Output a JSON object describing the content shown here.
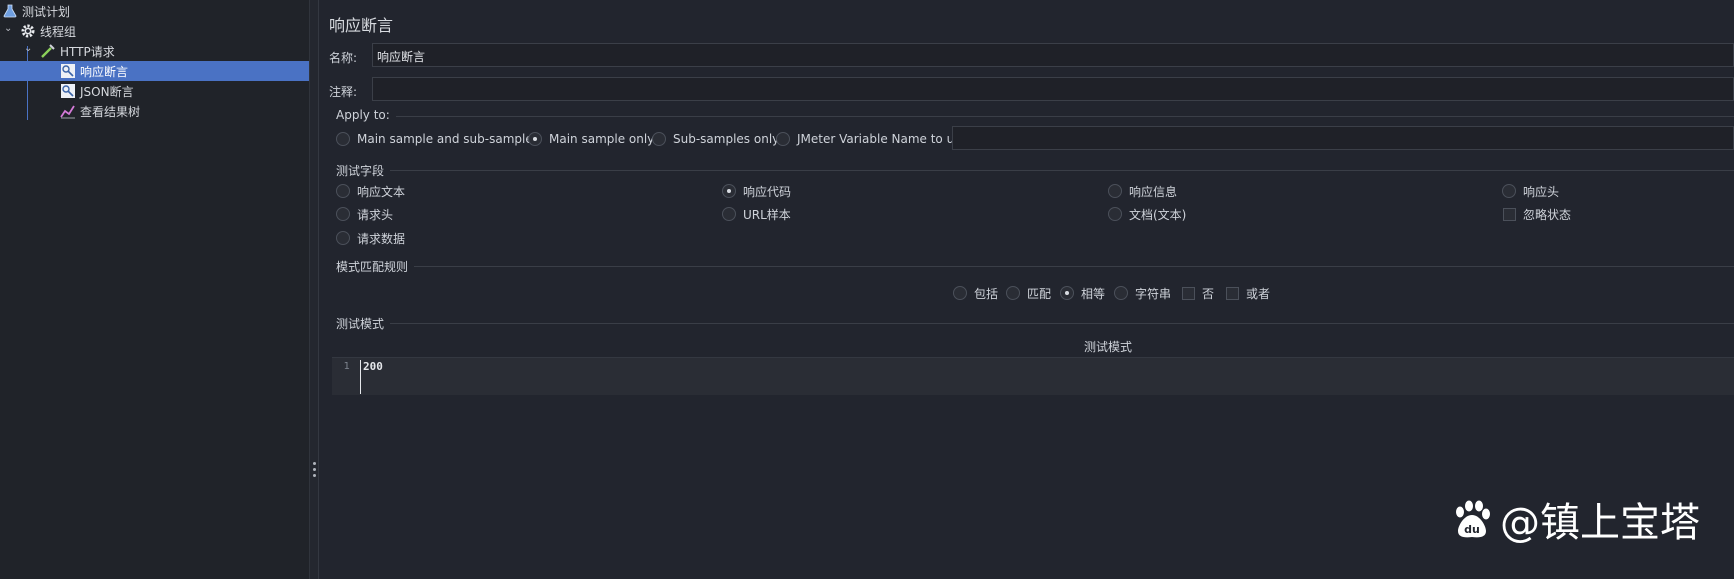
{
  "tree": {
    "items": [
      {
        "label": "测试计划",
        "icon": "flask-icon"
      },
      {
        "label": "线程组",
        "icon": "gear-icon"
      },
      {
        "label": "HTTP请求",
        "icon": "pipette-icon"
      },
      {
        "label": "响应断言",
        "icon": "user-search-icon",
        "selected": true
      },
      {
        "label": "JSON断言",
        "icon": "user-search-icon"
      },
      {
        "label": "查看结果树",
        "icon": "chart-icon"
      }
    ]
  },
  "panel": {
    "title": "响应断言",
    "name_label": "名称:",
    "name_value": "响应断言",
    "comment_label": "注释:",
    "comment_value": ""
  },
  "apply_to": {
    "title": "Apply to:",
    "options": [
      {
        "label": "Main sample and sub-samples",
        "selected": false
      },
      {
        "label": "Main sample only",
        "selected": true
      },
      {
        "label": "Sub-samples only",
        "selected": false
      },
      {
        "label": "JMeter Variable Name to use",
        "selected": false
      }
    ],
    "variable_value": ""
  },
  "test_field": {
    "title": "测试字段",
    "options": [
      {
        "label": "响应文本",
        "selected": false
      },
      {
        "label": "响应代码",
        "selected": true
      },
      {
        "label": "响应信息",
        "selected": false
      },
      {
        "label": "响应头",
        "selected": false
      },
      {
        "label": "请求头",
        "selected": false
      },
      {
        "label": "URL样本",
        "selected": false
      },
      {
        "label": "文档(文本)",
        "selected": false
      },
      {
        "label": "请求数据",
        "selected": false
      }
    ],
    "ignore_status_label": "忽略状态",
    "ignore_status_checked": false
  },
  "pattern_rules": {
    "title": "模式匹配规则",
    "radios": [
      {
        "label": "包括",
        "selected": false
      },
      {
        "label": "匹配",
        "selected": false
      },
      {
        "label": "相等",
        "selected": true
      },
      {
        "label": "字符串",
        "selected": false
      }
    ],
    "checks": [
      {
        "label": "否",
        "checked": false
      },
      {
        "label": "或者",
        "checked": false
      }
    ]
  },
  "test_patterns": {
    "title": "测试模式",
    "column_header": "测试模式",
    "rows": [
      {
        "line": "1",
        "value": "200"
      }
    ]
  },
  "watermark": {
    "text": "@镇上宝塔",
    "logo_text": "du"
  }
}
